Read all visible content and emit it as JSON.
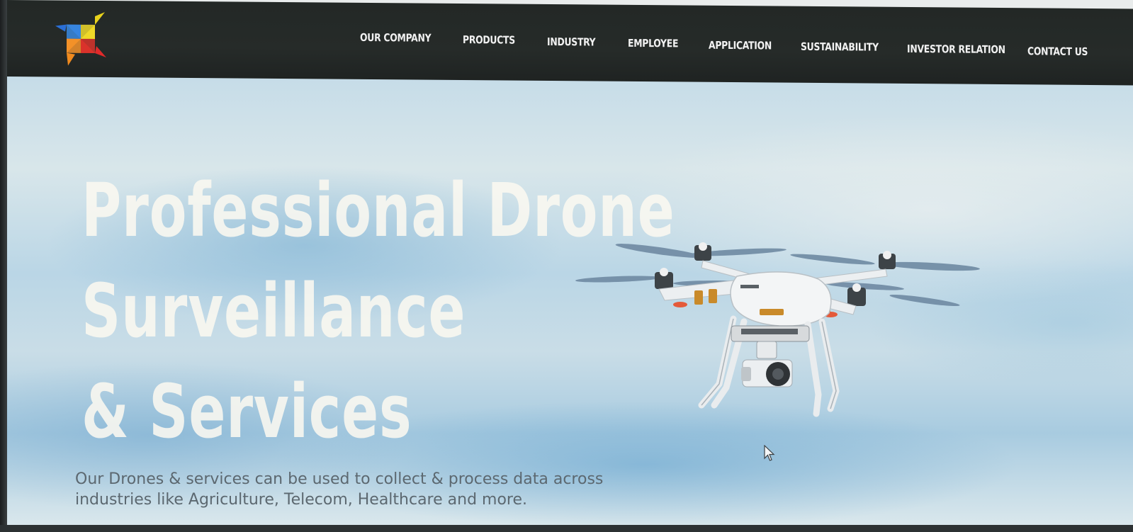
{
  "brand": {
    "logo_icon": "pinwheel-logo-icon",
    "colors": {
      "nav_bg": "#262b29",
      "nav_text": "#f2f2f2",
      "logo_yellow": "#e8d21c",
      "logo_red": "#e02a2a",
      "logo_blue": "#2a6fd6",
      "logo_orange": "#f08a1e"
    }
  },
  "nav": {
    "items": [
      {
        "label": "OUR COMPANY"
      },
      {
        "label": "PRODUCTS"
      },
      {
        "label": "INDUSTRY"
      },
      {
        "label": "EMPLOYEE"
      },
      {
        "label": "APPLICATION"
      },
      {
        "label": "SUSTAINABILITY"
      },
      {
        "label": "INVESTOR RELATION"
      },
      {
        "label": "CONTACT US"
      }
    ]
  },
  "hero": {
    "title_lines": [
      "Professional Drone",
      "Surveillance",
      "& Services"
    ],
    "subtitle_lines": [
      "Our Drones & services can be used to collect & process data across",
      "industries like Agriculture, Telecom, Healthcare and more."
    ],
    "image_icon": "quadcopter-drone-icon"
  },
  "cursor_icon": "mouse-pointer-icon"
}
